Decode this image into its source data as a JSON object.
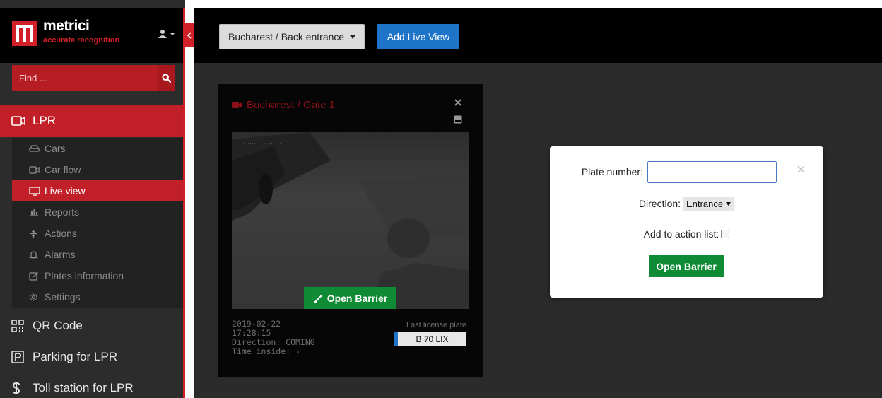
{
  "brand": {
    "name": "metrici",
    "tagline": "accurate recognition"
  },
  "search": {
    "placeholder": "Find ..."
  },
  "nav": {
    "lpr": "LPR",
    "sub_items": [
      "Cars",
      "Car flow",
      "Live view",
      "Reports",
      "Actions",
      "Alarms",
      "Plates information",
      "Settings"
    ],
    "qr_code": "QR Code",
    "parking": "Parking for LPR",
    "toll": "Toll station for LPR",
    "active": "Live view"
  },
  "toolbar": {
    "location": "Bucharest / Back entrance",
    "add_live_view": "Add Live View"
  },
  "camera": {
    "title": "Bucharest / Gate 1",
    "open_barrier": "Open Barrier",
    "date": "2019-02-22",
    "time": "17:28:15",
    "direction": "Direction: COMING",
    "time_inside": "Time inside: -",
    "plate_label": "Last license plate",
    "plate": "B 70 LIX"
  },
  "dialog": {
    "plate_number_label": "Plate number:",
    "plate_number_value": "",
    "direction_label": "Direction:",
    "direction_value": "Entrance",
    "action_list_label": "Add to action list:",
    "open_barrier": "Open Barrier"
  },
  "colors": {
    "brand_red": "#d12028",
    "nav_active": "#c22029",
    "primary_blue": "#1e74c9",
    "success_green": "#0e8b34"
  },
  "icons": {
    "logo": "metrici-logo-icon",
    "user": "user-icon",
    "search": "search-icon",
    "video": "video-camera-icon",
    "barrier": "barrier-icon",
    "close": "close-icon",
    "storage": "hard-drive-icon"
  }
}
